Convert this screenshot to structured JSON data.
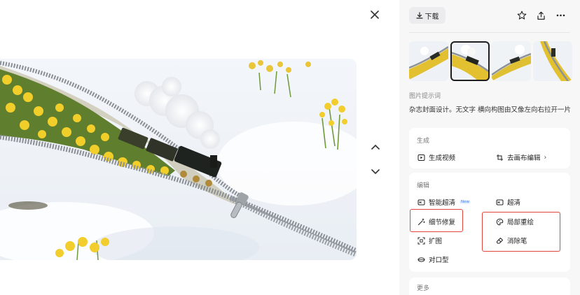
{
  "viewer": {
    "close_icon": "close-icon",
    "nav_up_icon": "chevron-up-icon",
    "nav_down_icon": "chevron-down-icon"
  },
  "toolbar": {
    "download_label": "下载",
    "icons": [
      "star-icon",
      "share-icon",
      "more-icon"
    ]
  },
  "thumbnails": {
    "count": 4,
    "active_index": 1
  },
  "prompt": {
    "label": "图片提示词",
    "text": "杂志封面设计。无文字 横向构图由又像左向右拉开一片白"
  },
  "generate": {
    "title": "生成",
    "items": [
      {
        "label": "生成视频",
        "icon": "video-icon"
      },
      {
        "label": "去画布编辑",
        "icon": "canvas-icon",
        "chevron": "›"
      }
    ]
  },
  "edit": {
    "title": "编辑",
    "items": [
      {
        "label": "智能超清",
        "icon": "hd-icon",
        "badge": "New"
      },
      {
        "label": "超清",
        "icon": "hd-icon"
      },
      {
        "label": "细节修复",
        "icon": "wand-icon"
      },
      {
        "label": "局部重绘",
        "icon": "palette-icon"
      },
      {
        "label": "扩图",
        "icon": "expand-icon"
      },
      {
        "label": "消除笔",
        "icon": "eraser-icon"
      },
      {
        "label": "对口型",
        "icon": "lips-icon"
      }
    ]
  },
  "more": {
    "title": "更多"
  },
  "colors": {
    "highlight": "#e2463b",
    "panel_bg": "#f7f7f8",
    "card_bg": "#ffffff"
  }
}
